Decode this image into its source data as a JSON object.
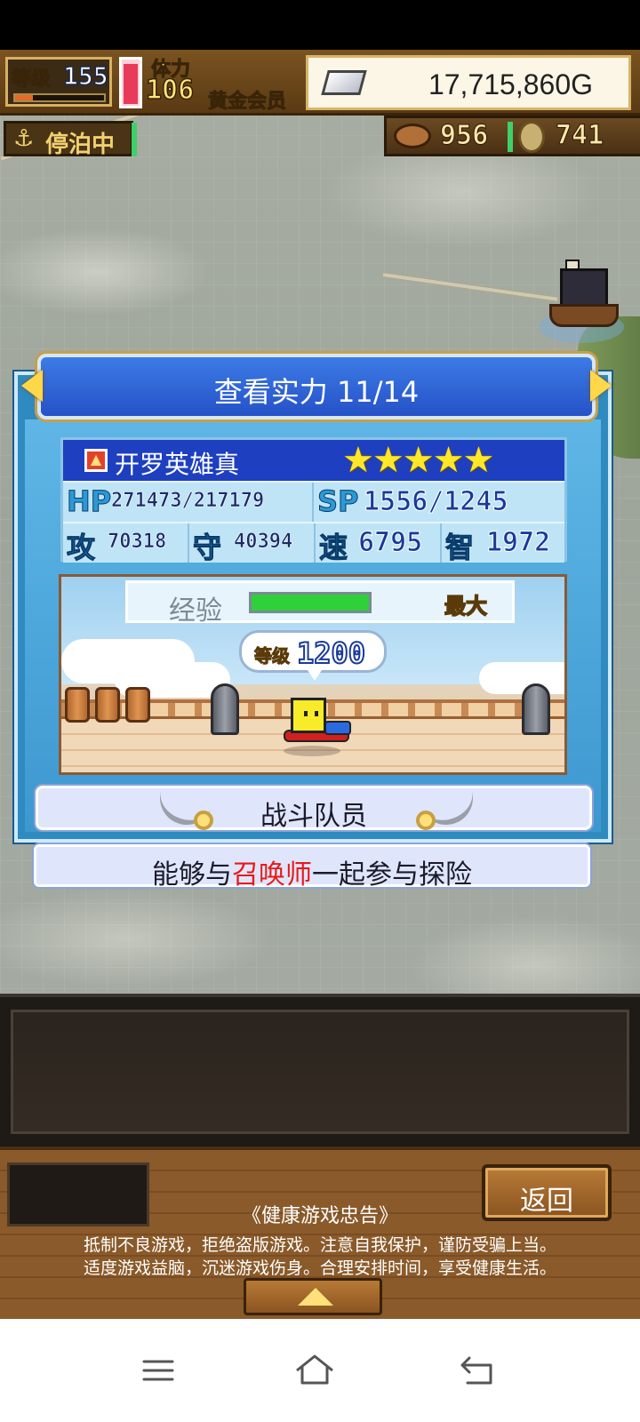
{
  "hud": {
    "level_label": "等级",
    "level_value": "155",
    "level_progress": 0.2,
    "stamina_label": "体力",
    "stamina_value": "106",
    "stamina_fill": 0.95,
    "membership": "黄金会员",
    "gold": "17,715,860G",
    "dock_status": "停泊中",
    "food_count": "956",
    "coin_count": "741"
  },
  "dialog": {
    "title": "查看实力 11/14",
    "character_name": "开罗英雄真",
    "rarity_stars": "★★★★★",
    "stats": {
      "hp_key": "HP",
      "hp_value": "271473/217179",
      "sp_key": "SP",
      "sp_value": "1556/1245",
      "atk_key": "攻",
      "atk_value": "70318",
      "def_key": "守",
      "def_value": "40394",
      "spd_key": "速",
      "spd_value": "6795",
      "int_key": "智",
      "int_value": "1972"
    },
    "exp_label": "经验",
    "exp_fill": 1.0,
    "exp_max_label": "最大",
    "level_bubble_label": "等级",
    "level_bubble_value": "1200",
    "role": "战斗队员",
    "description_before": "能够与",
    "description_highlight": "召唤师",
    "description_after": "一起参与探险"
  },
  "footer": {
    "back_button": "返回",
    "notice_title": "《健康游戏忠告》",
    "notice_line1": "抵制不良游戏，拒绝盗版游戏。注意自我保护，谨防受骗上当。",
    "notice_line2": "适度游戏益脑，沉迷游戏伤身。合理安排时间，享受健康生活。"
  },
  "navbar": {
    "icons": [
      "menu-icon",
      "home-icon",
      "back-icon"
    ]
  },
  "colors": {
    "dialog_blue": "#2f8ac0",
    "title_blue": "#2552c8",
    "highlight_red": "#e81818",
    "exp_green": "#2fd03a",
    "star_yellow": "#ffe82a"
  }
}
